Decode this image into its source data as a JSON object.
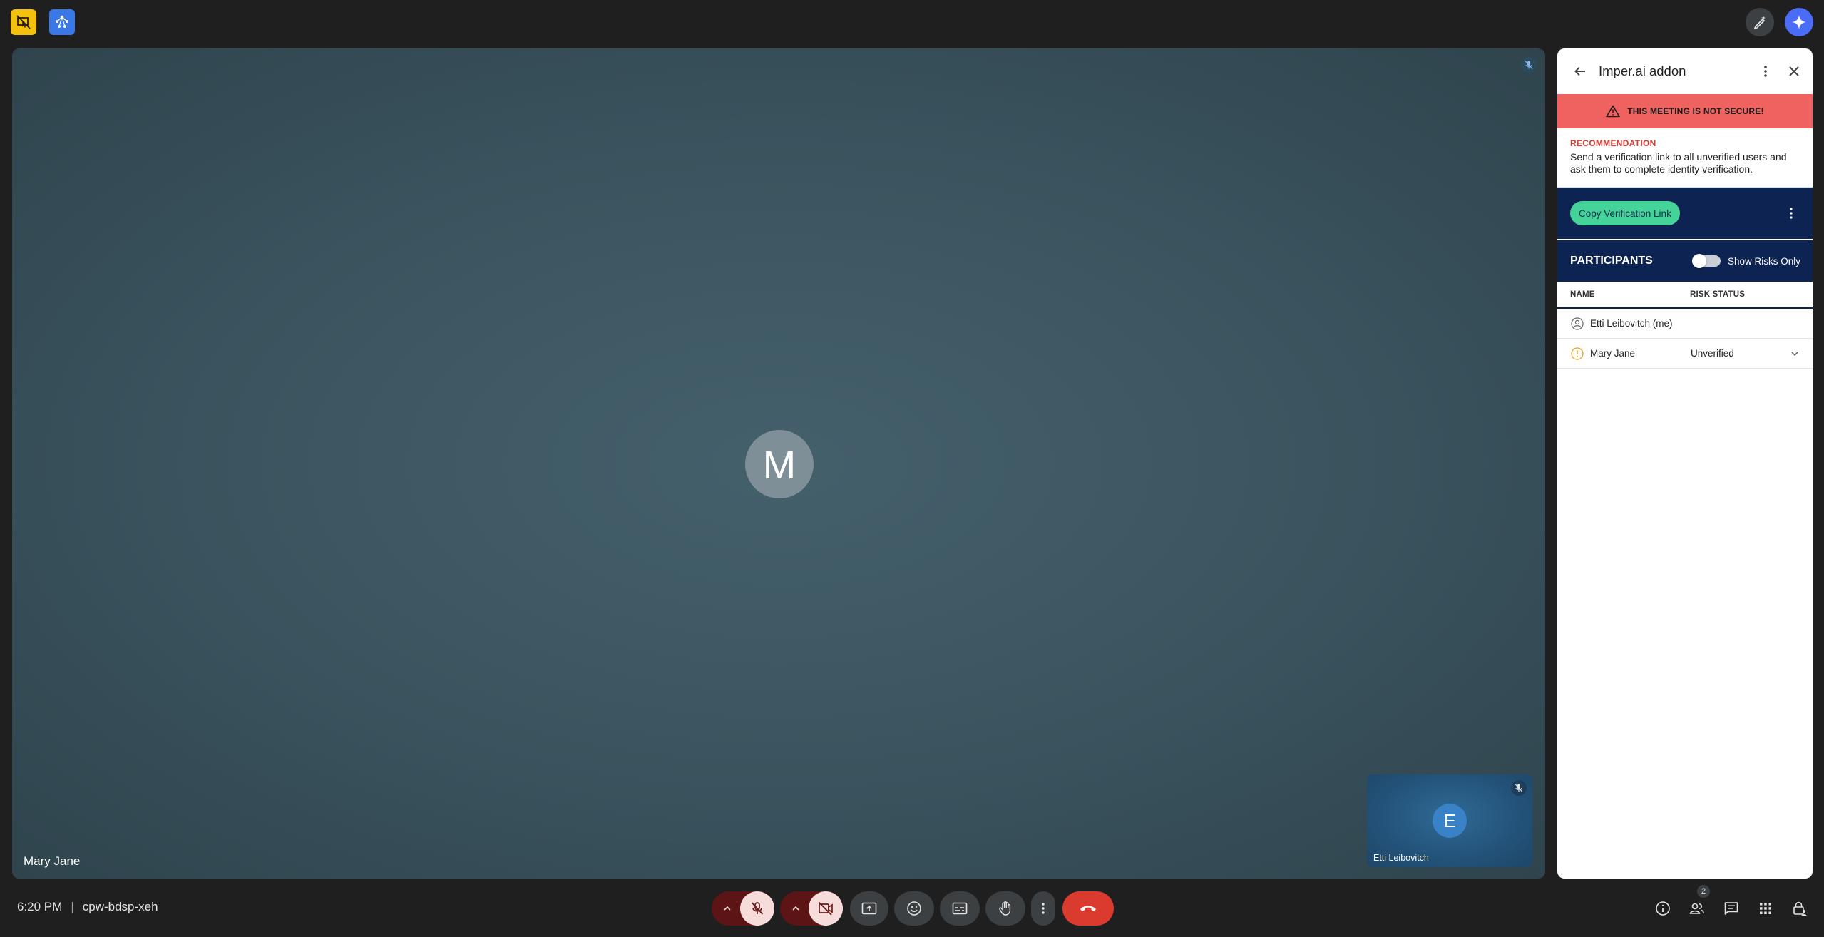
{
  "colors": {
    "accent": "#4a6cf7",
    "warning": "#f0625f",
    "navy": "#0d2452",
    "copy_button": "#45d39a",
    "end_call": "#db3a2f",
    "unverified_icon": "#e8a11c"
  },
  "top_left": {
    "app1_icon": "hide-cursor-icon",
    "app2_icon": "organization-icon"
  },
  "top_right": {
    "edit_icon": "pencil-sparkle-icon",
    "gemini_icon": "gemini-sparkle-icon"
  },
  "stage": {
    "avatar_letter": "M",
    "name": "Mary Jane",
    "muted_icon": "mic-off-icon"
  },
  "self_tile": {
    "avatar_letter": "E",
    "name": "Etti Leibovitch"
  },
  "panel": {
    "title": "Imper.ai addon",
    "warning": "THIS MEETING IS NOT SECURE!",
    "recommendation_title": "RECOMMENDATION",
    "recommendation_text": "Send a verification link to all unverified users and ask them to complete identity verification.",
    "copy_button": "Copy Verification Link",
    "participants_title": "PARTICIPANTS",
    "toggle_label": "Show Risks Only",
    "columns": {
      "name": "NAME",
      "risk": "RISK STATUS"
    },
    "rows": [
      {
        "name": "Etti Leibovitch (me)",
        "risk": "",
        "icon": "person-icon"
      },
      {
        "name": "Mary Jane",
        "risk": "Unverified",
        "icon": "alert-clock-icon"
      }
    ]
  },
  "bottom": {
    "time": "6:20 PM",
    "separator": "|",
    "meeting_code": "cpw-bdsp-xeh",
    "participants_count": "2"
  }
}
